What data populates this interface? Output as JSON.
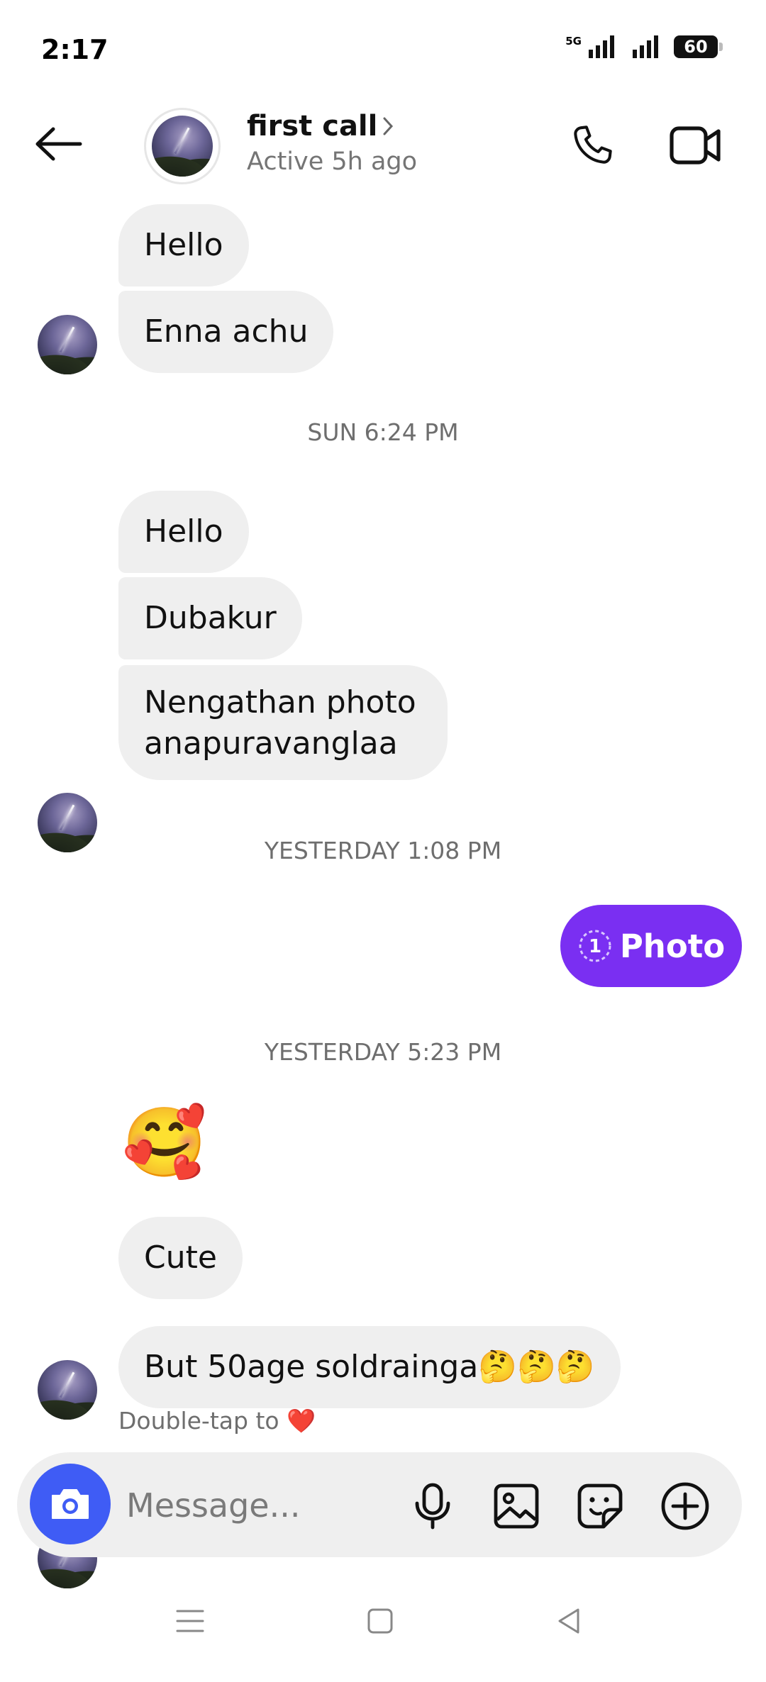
{
  "status_bar": {
    "time": "2:17",
    "network_label": "5G",
    "battery_level": "60"
  },
  "header": {
    "contact_name": "first call",
    "presence": "Active 5h ago"
  },
  "messages_group_1": [
    {
      "text": "Hello"
    },
    {
      "text": "Enna achu"
    }
  ],
  "timestamp_1": "SUN 6:24 PM",
  "messages_group_2": [
    {
      "text": "Hello"
    },
    {
      "text": "Dubakur"
    },
    {
      "text": "Nengathan photo anapuravanglaa"
    }
  ],
  "timestamp_2": "YESTERDAY 1:08 PM",
  "sent_photo": {
    "view_count": "1",
    "label": "Photo",
    "color": "#7a2ff2"
  },
  "timestamp_3": "YESTERDAY 5:23 PM",
  "messages_group_3": [
    {
      "text": "🥰"
    },
    {
      "text": "Cute"
    },
    {
      "text": "But 50age soldrainga🤔🤔🤔"
    }
  ],
  "double_tap_hint": "Double-tap to ❤️",
  "composer": {
    "placeholder": "Message...",
    "camera_color": "#3f5cf5",
    "icons": [
      "camera-icon",
      "microphone-icon",
      "gallery-icon",
      "sticker-icon",
      "plus-icon"
    ]
  }
}
